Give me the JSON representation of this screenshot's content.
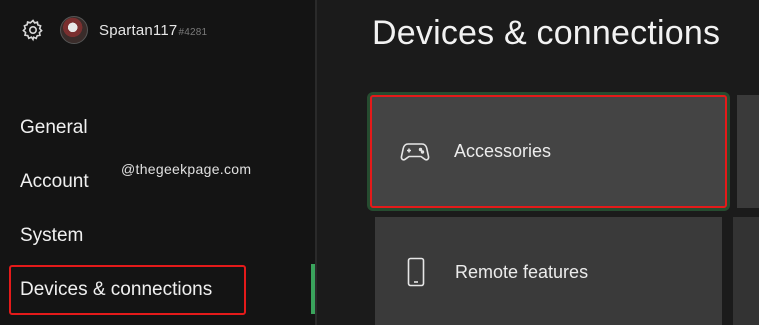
{
  "profile": {
    "gamertag": "Spartan117",
    "gamertag_suffix": "#4281"
  },
  "sidebar": {
    "items": [
      {
        "label": "General"
      },
      {
        "label": "Account"
      },
      {
        "label": "System"
      },
      {
        "label": "Devices & connections"
      }
    ],
    "selected_index": 3
  },
  "watermark": "@thegeekpage.com",
  "main": {
    "title": "Devices & connections",
    "tiles": [
      {
        "label": "Accessories",
        "icon": "controller-icon"
      },
      {
        "label": "Remote features",
        "icon": "phone-icon"
      }
    ]
  },
  "colors": {
    "highlight_red": "#e41a1a",
    "focus_green": "#3aa35c",
    "background": "#1b1b1b",
    "tile": "#444444"
  }
}
